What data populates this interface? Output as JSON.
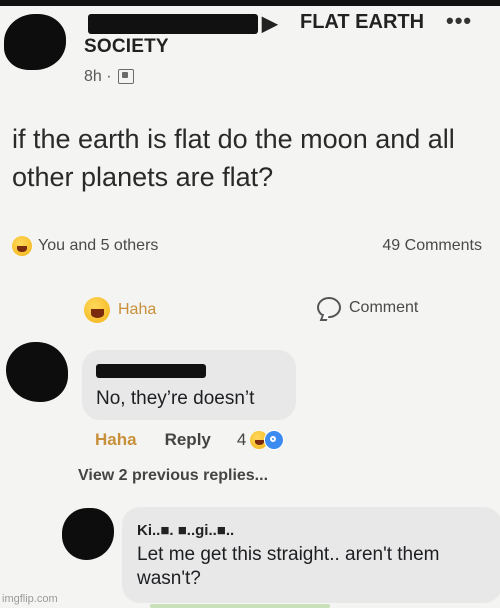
{
  "post": {
    "author": "SOCIETY",
    "group_arrow": "▶",
    "group_name": "FLAT EARTH",
    "more_icon": "•••",
    "time": "8h ·",
    "privacy_icon": "privacy-icon",
    "text": "if the earth is flat do the moon and all other planets are flat?",
    "reactions_summary": "You and 5 others",
    "comments_count": "49 Comments"
  },
  "actions": {
    "haha_label": "Haha",
    "comment_label": "Comment"
  },
  "comments": [
    {
      "text": "No, they’re doesn’t",
      "haha_label": "Haha",
      "reply_label": "Reply",
      "reaction_count": "4"
    },
    {
      "author": "Ki..■. ■..gi..■..",
      "text": "Let me get this straight.. aren't them wasn't?"
    }
  ],
  "view_previous": "View 2 previous replies...",
  "watermark": "imgflip.com",
  "colors": {
    "haha": "#c8903a",
    "bubble": "#e8e8e8",
    "wow": "#3b8bf0"
  }
}
